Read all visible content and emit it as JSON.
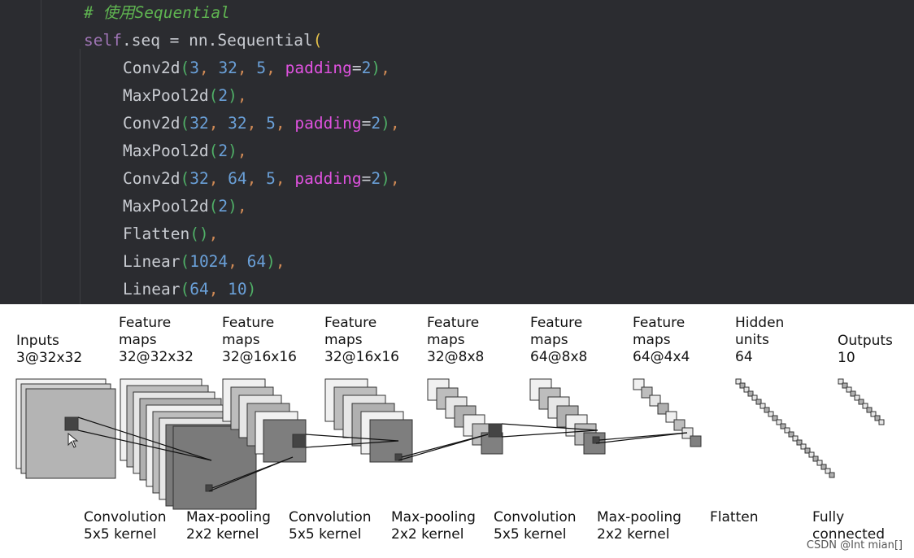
{
  "editor": {
    "lines": [
      [
        [
          "# 使用Sequential",
          "tk-comment"
        ]
      ],
      [
        [
          "self",
          "tk-self"
        ],
        [
          ".seq = nn.Sequential",
          "tk-plain"
        ],
        [
          "(",
          "tk-paren1"
        ]
      ],
      [
        [
          "Conv2d",
          "tk-plain"
        ],
        [
          "(",
          "tk-paren2"
        ],
        [
          "3",
          "tk-num"
        ],
        [
          ", ",
          "tk-comma"
        ],
        [
          "32",
          "tk-num"
        ],
        [
          ", ",
          "tk-comma"
        ],
        [
          "5",
          "tk-num"
        ],
        [
          ", ",
          "tk-comma"
        ],
        [
          "padding",
          "tk-kw"
        ],
        [
          "=",
          "tk-plain"
        ],
        [
          "2",
          "tk-num"
        ],
        [
          ")",
          "tk-paren2"
        ],
        [
          ",",
          "tk-comma"
        ]
      ],
      [
        [
          "MaxPool2d",
          "tk-plain"
        ],
        [
          "(",
          "tk-paren2"
        ],
        [
          "2",
          "tk-num"
        ],
        [
          ")",
          "tk-paren2"
        ],
        [
          ",",
          "tk-comma"
        ]
      ],
      [
        [
          "Conv2d",
          "tk-plain"
        ],
        [
          "(",
          "tk-paren2"
        ],
        [
          "32",
          "tk-num"
        ],
        [
          ", ",
          "tk-comma"
        ],
        [
          "32",
          "tk-num"
        ],
        [
          ", ",
          "tk-comma"
        ],
        [
          "5",
          "tk-num"
        ],
        [
          ", ",
          "tk-comma"
        ],
        [
          "padding",
          "tk-kw"
        ],
        [
          "=",
          "tk-plain"
        ],
        [
          "2",
          "tk-num"
        ],
        [
          ")",
          "tk-paren2"
        ],
        [
          ",",
          "tk-comma"
        ]
      ],
      [
        [
          "MaxPool2d",
          "tk-plain"
        ],
        [
          "(",
          "tk-paren2"
        ],
        [
          "2",
          "tk-num"
        ],
        [
          ")",
          "tk-paren2"
        ],
        [
          ",",
          "tk-comma"
        ]
      ],
      [
        [
          "Conv2d",
          "tk-plain"
        ],
        [
          "(",
          "tk-paren2"
        ],
        [
          "32",
          "tk-num"
        ],
        [
          ", ",
          "tk-comma"
        ],
        [
          "64",
          "tk-num"
        ],
        [
          ", ",
          "tk-comma"
        ],
        [
          "5",
          "tk-num"
        ],
        [
          ", ",
          "tk-comma"
        ],
        [
          "padding",
          "tk-kw"
        ],
        [
          "=",
          "tk-plain"
        ],
        [
          "2",
          "tk-num"
        ],
        [
          ")",
          "tk-paren2"
        ],
        [
          ",",
          "tk-comma"
        ]
      ],
      [
        [
          "MaxPool2d",
          "tk-plain"
        ],
        [
          "(",
          "tk-paren2"
        ],
        [
          "2",
          "tk-num"
        ],
        [
          ")",
          "tk-paren2"
        ],
        [
          ",",
          "tk-comma"
        ]
      ],
      [
        [
          "Flatten",
          "tk-plain"
        ],
        [
          "()",
          "tk-paren2"
        ],
        [
          ",",
          "tk-comma"
        ]
      ],
      [
        [
          "Linear",
          "tk-plain"
        ],
        [
          "(",
          "tk-paren2"
        ],
        [
          "1024",
          "tk-num"
        ],
        [
          ", ",
          "tk-comma"
        ],
        [
          "64",
          "tk-num"
        ],
        [
          ")",
          "tk-paren2"
        ],
        [
          ",",
          "tk-comma"
        ]
      ],
      [
        [
          "Linear",
          "tk-plain"
        ],
        [
          "(",
          "tk-paren2"
        ],
        [
          "64",
          "tk-num"
        ],
        [
          ", ",
          "tk-comma"
        ],
        [
          "10",
          "tk-num"
        ],
        [
          ")",
          "tk-paren2"
        ]
      ]
    ]
  },
  "diagram": {
    "layers": [
      {
        "title": "Inputs",
        "shape": "3@32x32"
      },
      {
        "title": "Feature\nmaps",
        "shape": "32@32x32"
      },
      {
        "title": "Feature\nmaps",
        "shape": "32@16x16"
      },
      {
        "title": "Feature\nmaps",
        "shape": "32@16x16"
      },
      {
        "title": "Feature\nmaps",
        "shape": "32@8x8"
      },
      {
        "title": "Feature\nmaps",
        "shape": "64@8x8"
      },
      {
        "title": "Feature\nmaps",
        "shape": "64@4x4"
      },
      {
        "title": "Hidden\nunits",
        "shape": "64"
      },
      {
        "title": "Outputs",
        "shape": "10"
      }
    ],
    "operations": [
      {
        "name": "Convolution",
        "detail": "5x5 kernel"
      },
      {
        "name": "Max-pooling",
        "detail": "2x2 kernel"
      },
      {
        "name": "Convolution",
        "detail": "5x5 kernel"
      },
      {
        "name": "Max-pooling",
        "detail": "2x2 kernel"
      },
      {
        "name": "Convolution",
        "detail": "5x5 kernel"
      },
      {
        "name": "Max-pooling",
        "detail": "2x2 kernel"
      },
      {
        "name": "Flatten",
        "detail": ""
      },
      {
        "name": "Fully\nconnected",
        "detail": ""
      }
    ],
    "watermark": "CSDN @Int mian[]"
  }
}
